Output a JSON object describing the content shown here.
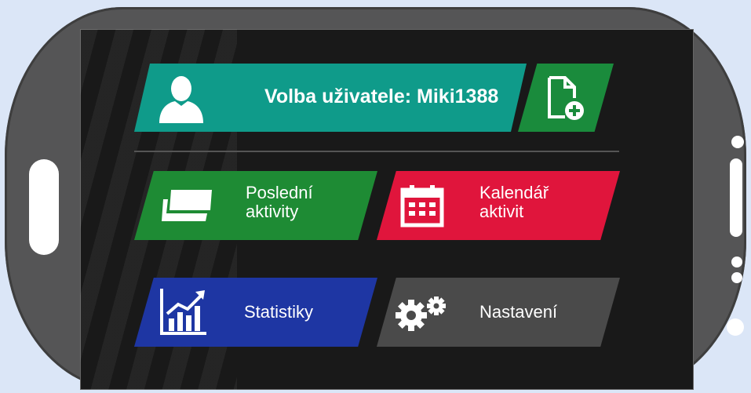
{
  "user_tile": {
    "label": "Volba uživatele: Miki1388",
    "icon": "user-silhouette-icon"
  },
  "add_tile": {
    "icon": "add-document-icon"
  },
  "tiles": [
    {
      "line1": "Poslední",
      "line2": "aktivity",
      "icon": "cards-icon",
      "color": "#1e8b34"
    },
    {
      "line1": "Kalendář",
      "line2": "aktivit",
      "icon": "calendar-icon",
      "color": "#e0153c"
    },
    {
      "line1": "Statistiky",
      "line2": "",
      "icon": "chart-up-icon",
      "color": "#1e36a3"
    },
    {
      "line1": "Nastavení",
      "line2": "",
      "icon": "gears-icon",
      "color": "#4a4a4a"
    }
  ],
  "colors": {
    "phone_body": "#555556",
    "screen": "#191919",
    "teal": "#0f9b8a",
    "dark_green": "#1a8b3c"
  }
}
